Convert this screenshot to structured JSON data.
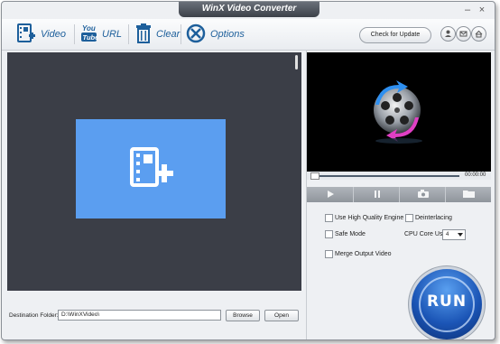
{
  "window": {
    "title": "WinX Video Converter"
  },
  "toolbar": {
    "video_label": "Video",
    "url_label": "URL",
    "clear_label": "Clear",
    "options_label": "Options",
    "check_update_label": "Check for Update"
  },
  "player": {
    "timecode": "00:00:00",
    "progress": 0
  },
  "options": {
    "high_quality_label": "Use High Quality Engine",
    "deinterlacing_label": "Deinterlacing",
    "safe_mode_label": "Safe Mode",
    "cpu_core_label": "CPU Core Use:",
    "cpu_core_value": "4",
    "merge_label": "Merge Output Video"
  },
  "run_label": "RUN",
  "destination": {
    "label": "Destination Folder:",
    "path": "D:\\WinXVideo\\",
    "browse_label": "Browse",
    "open_label": "Open"
  },
  "colors": {
    "accent": "#1d5f9b",
    "drop_zone": "#5b9ef0",
    "pane_bg": "#3b3e47"
  }
}
